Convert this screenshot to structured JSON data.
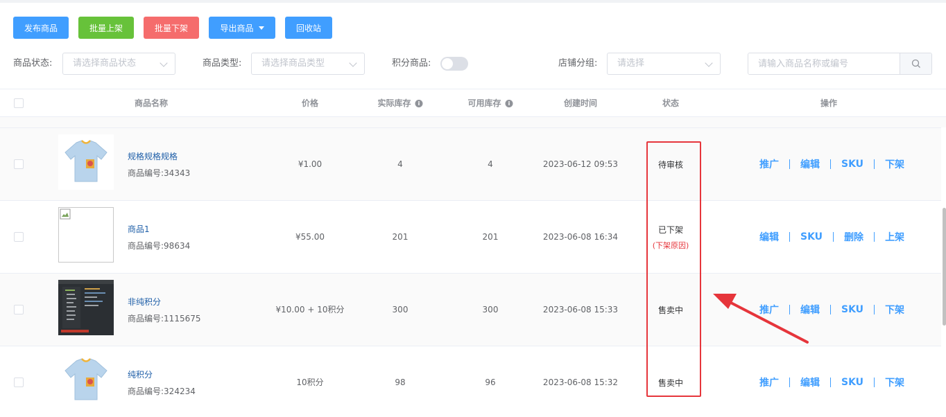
{
  "toolbar": {
    "publish": "发布商品",
    "batch_on": "批量上架",
    "batch_off": "批量下架",
    "export": "导出商品",
    "recycle": "回收站"
  },
  "filters": {
    "status_label": "商品状态:",
    "status_placeholder": "请选择商品状态",
    "type_label": "商品类型:",
    "type_placeholder": "请选择商品类型",
    "points_label": "积分商品:",
    "group_label": "店铺分组:",
    "group_placeholder": "请选择",
    "search_placeholder": "请输入商品名称或编号"
  },
  "table": {
    "headers": {
      "name": "商品名称",
      "price": "价格",
      "actual_stock": "实际库存",
      "available_stock": "可用库存",
      "created": "创建时间",
      "status": "状态",
      "ops": "操作"
    },
    "rows": [
      {
        "name": "规格规格规格",
        "code": "商品编号:34343",
        "price": "¥1.00",
        "actual": "4",
        "available": "4",
        "created": "2023-06-12 09:53",
        "status": "待审核",
        "reason": "",
        "ops": [
          "推广",
          "编辑",
          "SKU",
          "下架"
        ]
      },
      {
        "name": "商品1",
        "code": "商品编号:98634",
        "price": "¥55.00",
        "actual": "201",
        "available": "201",
        "created": "2023-06-08 16:34",
        "status": "已下架",
        "reason": "(下架原因)",
        "ops": [
          "编辑",
          "SKU",
          "删除",
          "上架"
        ]
      },
      {
        "name": "非纯积分",
        "code": "商品编号:1115675",
        "price": "¥10.00 + 10积分",
        "actual": "300",
        "available": "300",
        "created": "2023-06-08 15:33",
        "status": "售卖中",
        "reason": "",
        "ops": [
          "推广",
          "编辑",
          "SKU",
          "下架"
        ]
      },
      {
        "name": "纯积分",
        "code": "商品编号:324234",
        "price": "10积分",
        "actual": "98",
        "available": "96",
        "created": "2023-06-08 15:32",
        "status": "售卖中",
        "reason": "",
        "ops": [
          "推广",
          "编辑",
          "SKU",
          "下架"
        ]
      }
    ]
  },
  "colors": {
    "primary": "#409eff",
    "success": "#67c23a",
    "danger": "#f56c6c",
    "annotation": "#e6353b"
  }
}
